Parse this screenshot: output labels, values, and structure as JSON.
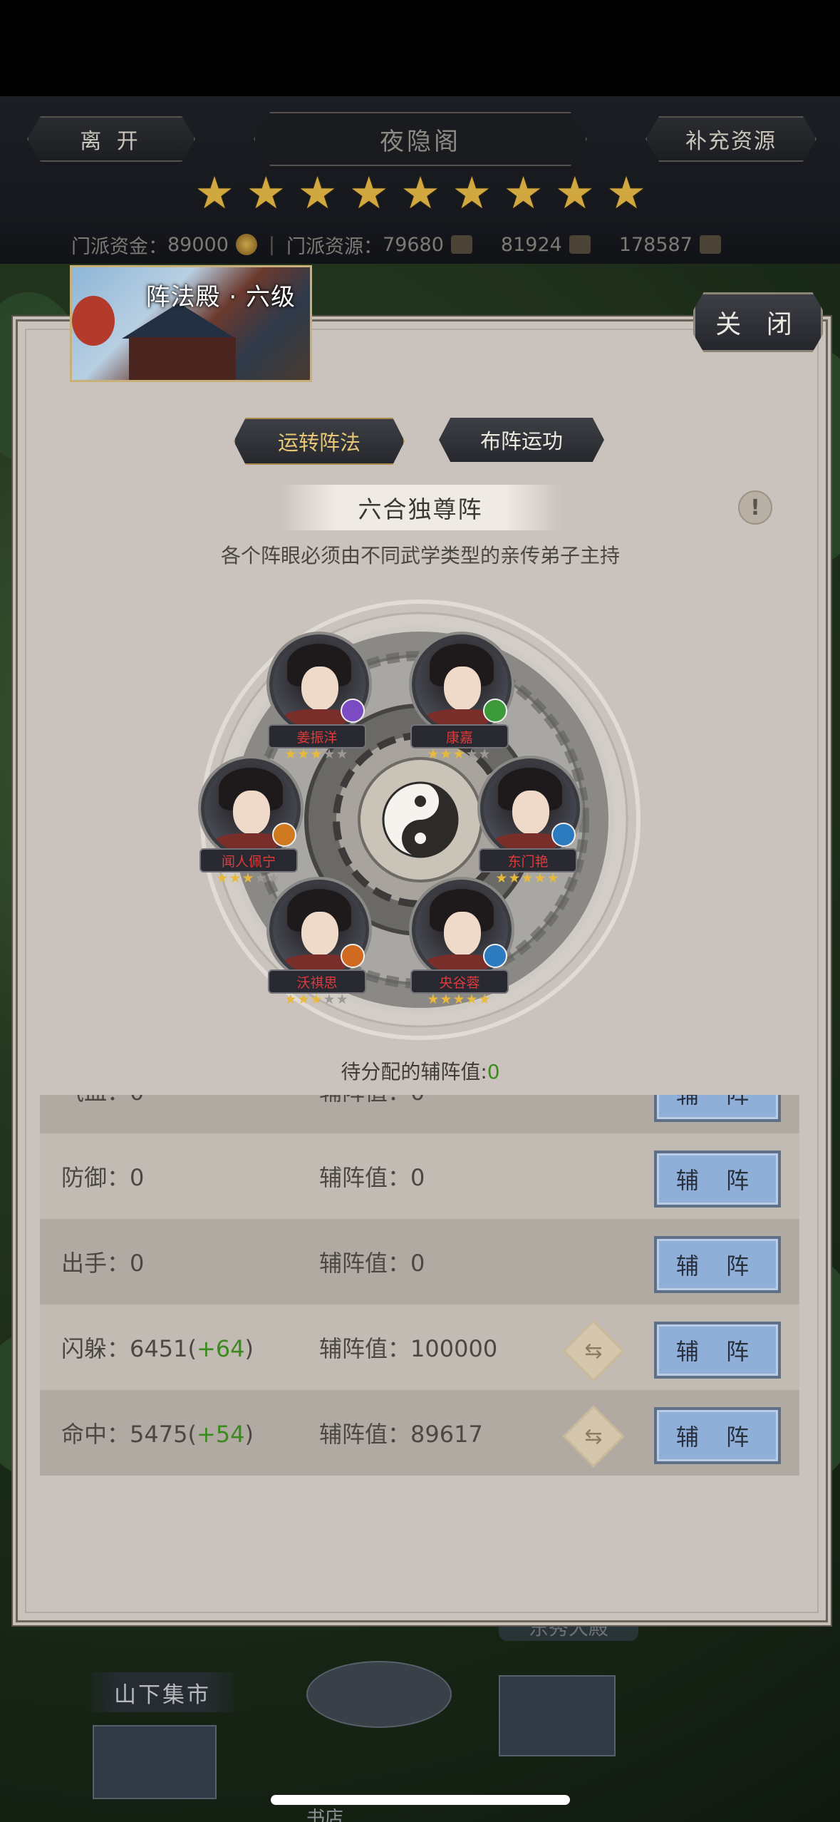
{
  "hud": {
    "leave": "离 开",
    "location": "夜隐阁",
    "replenish": "补充资源",
    "stars": 9,
    "funds_label": "门派资金：",
    "funds_value": "89000",
    "resources_label": "门派资源：",
    "resources_value": "79680",
    "res2_value": "81924",
    "res3_value": "178587"
  },
  "panel": {
    "title": "阵法殿 · 六级",
    "close": "关 闭",
    "tab_run": "运转阵法",
    "tab_deploy": "布阵运功",
    "formation_name": "六合独尊阵",
    "info": "!",
    "description": "各个阵眼必须由不同武学类型的亲传弟子主持",
    "pending_label": "待分配的辅阵值:",
    "pending_value": "0"
  },
  "heroes": [
    {
      "name": "姜振洋",
      "stars": 3,
      "max_stars": 5,
      "badge_color": "#7b4bc4"
    },
    {
      "name": "康嘉",
      "stars": 3,
      "max_stars": 5,
      "badge_color": "#3d9a3a"
    },
    {
      "name": "闻人佩宁",
      "stars": 3,
      "max_stars": 5,
      "badge_color": "#d07a20"
    },
    {
      "name": "东门艳",
      "stars": 5,
      "max_stars": 5,
      "badge_color": "#2d7bbf"
    },
    {
      "name": "沃祺思",
      "stars": 3,
      "max_stars": 5,
      "badge_color": "#d06a20"
    },
    {
      "name": "央谷蓉",
      "stars": 5,
      "max_stars": 5,
      "badge_color": "#2d7bbf"
    }
  ],
  "stats": [
    {
      "label": "气血：",
      "value": "0",
      "bonus": "",
      "assist_label": "辅阵值：",
      "assist_value": "0",
      "has_swap": false,
      "button": "辅 阵"
    },
    {
      "label": "防御：",
      "value": "0",
      "bonus": "",
      "assist_label": "辅阵值：",
      "assist_value": "0",
      "has_swap": false,
      "button": "辅 阵"
    },
    {
      "label": "出手：",
      "value": "0",
      "bonus": "",
      "assist_label": "辅阵值：",
      "assist_value": "0",
      "has_swap": false,
      "button": "辅 阵"
    },
    {
      "label": "闪躲：",
      "value": "6451",
      "bonus": "+64",
      "assist_label": "辅阵值：",
      "assist_value": "100000",
      "has_swap": true,
      "button": "辅 阵"
    },
    {
      "label": "命中：",
      "value": "5475",
      "bonus": "+54",
      "assist_label": "辅阵值：",
      "assist_value": "89617",
      "has_swap": true,
      "button": "辅 阵"
    }
  ],
  "scene": {
    "market": "山下集市",
    "east_hall": "东秀大殿",
    "book": "书店"
  },
  "colors": {
    "gold_star": "#d1a73f",
    "bonus_green": "#3a8a1e",
    "hero_name_red": "#e03a3a",
    "assist_button": "#8faed8"
  }
}
